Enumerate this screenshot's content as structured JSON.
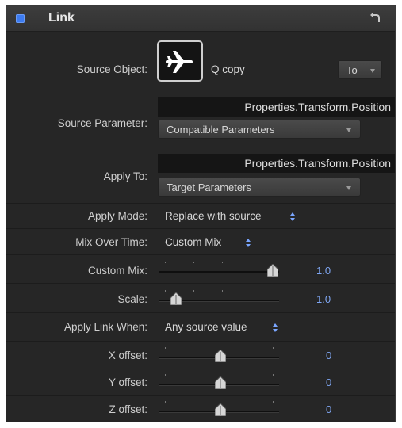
{
  "inspector": {
    "title": "Link",
    "source_object": {
      "label": "Source Object:",
      "object_name": "Q copy",
      "to_button": "To"
    },
    "source_parameter": {
      "label": "Source Parameter:",
      "path": "Properties.Transform.Position",
      "popup": "Compatible Parameters"
    },
    "apply_to": {
      "label": "Apply To:",
      "path": "Properties.Transform.Position",
      "popup": "Target Parameters"
    },
    "apply_mode": {
      "label": "Apply Mode:",
      "value": "Replace with source"
    },
    "mix_over_time": {
      "label": "Mix Over Time:",
      "value": "Custom Mix"
    },
    "custom_mix": {
      "label": "Custom Mix:",
      "value": "1.0"
    },
    "scale": {
      "label": "Scale:",
      "value": "1.0"
    },
    "apply_link_when": {
      "label": "Apply Link When:",
      "value": "Any source value"
    },
    "x_offset": {
      "label": "X offset:",
      "value": "0"
    },
    "y_offset": {
      "label": "Y offset:",
      "value": "0"
    },
    "z_offset": {
      "label": "Z offset:",
      "value": "0"
    }
  },
  "colors": {
    "panel": "#262626",
    "accent_blue": "#3d7bf0",
    "value_blue": "#7fa6f2",
    "field": "#151515"
  },
  "icons": {
    "enable": "checkbox-icon",
    "reset": "reset-arrow-icon",
    "object": "airplane-icon"
  }
}
